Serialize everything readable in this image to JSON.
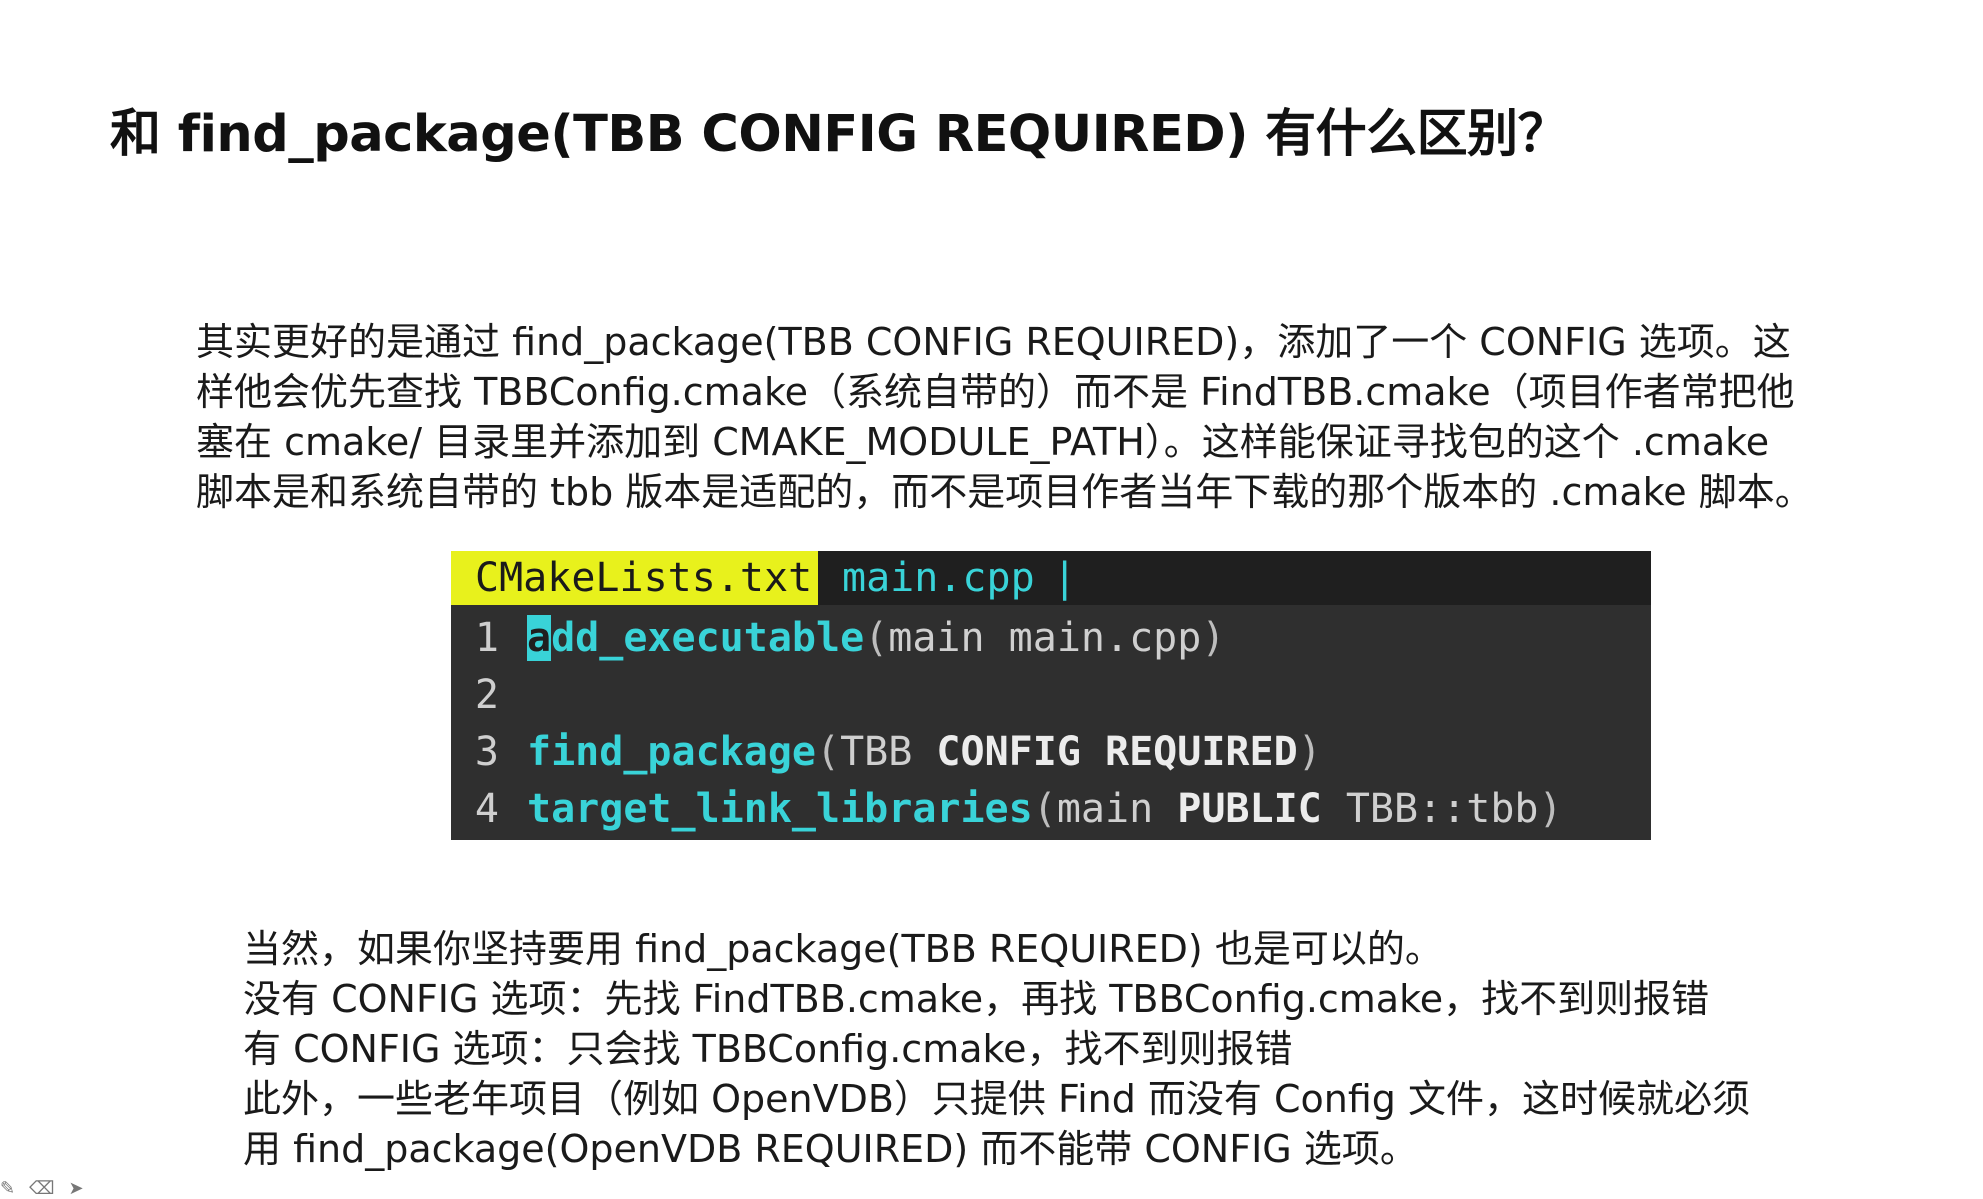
{
  "title": "和 find_package(TBB CONFIG REQUIRED) 有什么区别？",
  "paragraph1": {
    "lines": [
      "其实更好的是通过 find_package(TBB CONFIG REQUIRED)，添加了一个 CONFIG 选项。这",
      "样他会优先查找 TBBConfig.cmake（系统自带的）而不是 FindTBB.cmake（项目作者常把他",
      "塞在 cmake/ 目录里并添加到 CMAKE_MODULE_PATH）。这样能保证寻找包的这个 .cmake",
      "脚本是和系统自带的 tbb 版本是适配的，而不是项目作者当年下载的那个版本的 .cmake 脚本。"
    ]
  },
  "editor": {
    "tabs": [
      {
        "label": "CMakeLists.txt",
        "active": true
      },
      {
        "label": "main.cpp",
        "active": false
      }
    ],
    "tab_separator": "|",
    "lines": [
      {
        "num": "1",
        "cursor_char": "a",
        "cmd_rest": "dd_executable",
        "open": "(",
        "args": "main main.cpp",
        "close": ")"
      },
      {
        "num": "2"
      },
      {
        "num": "3",
        "cmd": "find_package",
        "open": "(",
        "arg1": "TBB ",
        "kw1": "CONFIG",
        "sp": " ",
        "kw2": "REQUIRED",
        "close": ")"
      },
      {
        "num": "4",
        "cmd": "target_link_libraries",
        "open": "(",
        "arg1": "main ",
        "kw1": "PUBLIC",
        "arg2": " TBB::tbb",
        "close": ")"
      }
    ]
  },
  "paragraph2": {
    "lines": [
      "当然，如果你坚持要用 find_package(TBB REQUIRED) 也是可以的。",
      "没有 CONFIG 选项：先找 FindTBB.cmake，再找 TBBConfig.cmake，找不到则报错",
      "有 CONFIG 选项：只会找 TBBConfig.cmake，找不到则报错",
      "此外，一些老年项目（例如 OpenVDB）只提供 Find 而没有 Config 文件，这时候就必须",
      "用 find_package(OpenVDB REQUIRED) 而不能带 CONFIG 选项。"
    ]
  },
  "colors": {
    "active_tab": "#e8f11c",
    "command": "#39d3d8",
    "editor_bg": "#2f2f2f"
  }
}
